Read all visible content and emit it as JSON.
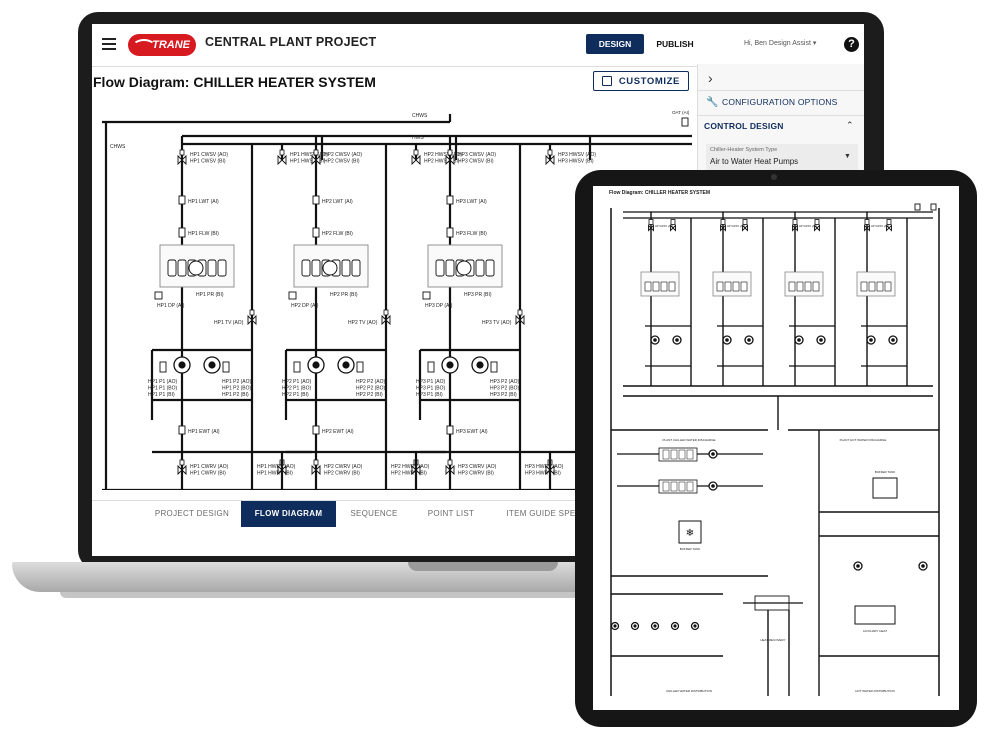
{
  "app": {
    "logo_text": "TRANE",
    "title": "CENTRAL PLANT PROJECT",
    "design_label": "DESIGN",
    "publish_label": "PUBLISH",
    "greeting": "Hi, Ben Design Assist ▾",
    "help_glyph": "?"
  },
  "page": {
    "title": "Flow Diagram: CHILLER HEATER SYSTEM",
    "customize_label": "CUSTOMIZE"
  },
  "side_panel": {
    "collapse_glyph": "›",
    "config_label": "CONFIGURATION OPTIONS",
    "section_label": "CONTROL DESIGN",
    "select_caption": "Chiller-Heater System Type",
    "select_value": "Air to Water Heat Pumps"
  },
  "tabs": [
    "PROJECT DESIGN",
    "FLOW DIAGRAM",
    "SEQUENCE",
    "POINT LIST",
    "ITEM GUIDE SPEC"
  ],
  "active_tab": 1,
  "diagram": {
    "header_chws": "CHWS",
    "header_hws": "HWS",
    "left_chws": "CHWS",
    "oat": "OAT (AI)",
    "units": [
      {
        "cwsv": "HP1 CWSV (AO)\nHP1 CWSV (BI)",
        "hwsv": "HP1 HWSV (AO)\nHP1 HWSV (BI)",
        "lwt": "HP1 LWT (AI)",
        "flw": "HP1 FLW (BI)",
        "dp": "HP1 DP (AI)",
        "pr": "HP1 PR (BI)",
        "tv": "HP1 TV (AO)",
        "p1": "HP1 P1 (AO)\nHP1 P1 (BO)\nHP1 P1 (BI)",
        "p2": "HP1 P2 (AO)\nHP1 P2 (BO)\nHP1 P2 (BI)",
        "ewt": "HP1 EWT (AI)",
        "cwrv": "HP1 CWRV (AO)\nHP1 CWRV (BI)",
        "hwrv": "HP1 HWRV (AO)\nHP1 HWRV (BI)"
      },
      {
        "cwsv": "HP2 CWSV (AO)\nHP2 CWSV (BI)",
        "hwsv": "HP2 HWSV (AO)\nHP2 HWSV (BI)",
        "lwt": "HP2 LWT (AI)",
        "flw": "HP2 FLW (BI)",
        "dp": "HP2 DP (AI)",
        "pr": "HP2 PR (BI)",
        "tv": "HP2 TV (AO)",
        "p1": "HP2 P1 (AO)\nHP2 P1 (BO)\nHP2 P1 (BI)",
        "p2": "HP2 P2 (AO)\nHP2 P2 (BO)\nHP2 P2 (BI)",
        "ewt": "HP2 EWT (AI)",
        "cwrv": "HP2 CWRV (AO)\nHP2 CWRV (BI)",
        "hwrv": "HP2 HWRV (AO)\nHP2 HWRV (BI)"
      },
      {
        "cwsv": "HP3 CWSV (AO)\nHP3 CWSV (BI)",
        "hwsv": "HP3 HWSV (AO)\nHP3 HWSV (BI)",
        "lwt": "HP3 LWT (AI)",
        "flw": "HP3 FLW (BI)",
        "dp": "HP3 DP (AI)",
        "pr": "HP3 PR (BI)",
        "tv": "HP3 TV (AO)",
        "p1": "HP3 P1 (AO)\nHP3 P1 (BO)\nHP3 P1 (BI)",
        "p2": "HP3 P2 (AO)\nHP3 P2 (BO)\nHP3 P2 (BI)",
        "ewt": "HP3 EWT (AI)",
        "cwrv": "HP3 CWRV (AO)\nHP3 CWRV (BI)",
        "hwrv": "HP3 HWRV (AO)\nHP3 HWRV (BI)"
      }
    ]
  },
  "tablet": {
    "title": "Flow Diagram: CHILLER HEATER SYSTEM",
    "labels": {
      "chilled_discharge": "PLANT CHILLED WATER DISCHARGE",
      "hot_discharge": "PLANT HOT WATER DISCHARGE",
      "buffer_tank_left": "BUFFER TANK",
      "buffer_tank_right": "BUFFER TANK",
      "auxiliary_heat": "AUXILIARY HEAT",
      "heat_recovery": "HEAT RECOVERY",
      "chilled_distribution": "CHILLED WATER DISTRIBUTION",
      "hot_distribution": "HOT WATER DISTRIBUTION"
    }
  },
  "colors": {
    "primary": "#0f2d5c",
    "brand_red": "#d71920",
    "pipe": "#111111"
  }
}
